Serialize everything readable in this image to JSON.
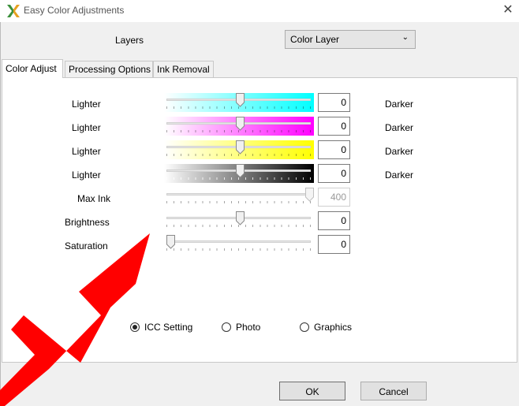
{
  "window": {
    "title": "Easy Color Adjustments",
    "close_glyph": "✕"
  },
  "layers": {
    "label": "Layers",
    "selected": "Color Layer"
  },
  "tabs": [
    {
      "label": "Color Adjust",
      "active": true
    },
    {
      "label": "Processing Options",
      "active": false
    },
    {
      "label": "Ink Removal",
      "active": false
    }
  ],
  "rows": [
    {
      "left": "Lighter",
      "value": "0",
      "right": "Darker",
      "level": 0.5,
      "color": "#00ffff"
    },
    {
      "left": "Lighter",
      "value": "0",
      "right": "Darker",
      "level": 0.5,
      "color": "#ff00ff"
    },
    {
      "left": "Lighter",
      "value": "0",
      "right": "Darker",
      "level": 0.5,
      "color": "#ffff00"
    },
    {
      "left": "Lighter",
      "value": "0",
      "right": "Darker",
      "level": 0.5,
      "color": "#000000"
    },
    {
      "left": "Max Ink",
      "value": "400",
      "level": 1.0,
      "disabled": true
    },
    {
      "left": "Brightness",
      "value": "0",
      "level": 0.5
    },
    {
      "left": "Saturation",
      "value": "0",
      "level": 0.0
    }
  ],
  "radios": [
    {
      "label": "ICC Setting",
      "checked": true
    },
    {
      "label": "Photo",
      "checked": false
    },
    {
      "label": "Graphics",
      "checked": false
    }
  ],
  "buttons": {
    "ok": "OK",
    "cancel": "Cancel"
  },
  "annotation": {
    "arrow_color": "#ff0000"
  }
}
